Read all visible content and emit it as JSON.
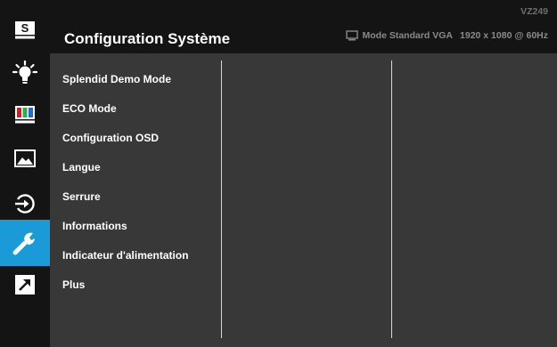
{
  "header": {
    "title": "Configuration Système",
    "model": "VZ249",
    "mode": "Mode Standard VGA",
    "resolution": "1920 x 1080 @ 60Hz"
  },
  "sidebar": {
    "icons": [
      {
        "name": "splendid-icon",
        "label": "S"
      },
      {
        "name": "blue-light-filter-icon"
      },
      {
        "name": "color-icon"
      },
      {
        "name": "image-icon"
      },
      {
        "name": "input-select-icon"
      },
      {
        "name": "system-setup-icon",
        "active": true
      },
      {
        "name": "shortcut-icon"
      }
    ],
    "accent_color": "#1a9ad6"
  },
  "menu": {
    "items": [
      "Splendid Demo Mode",
      "ECO Mode",
      "Configuration OSD",
      "Langue",
      "Serrure",
      "Informations",
      "Indicateur d'alimentation",
      "Plus"
    ]
  }
}
